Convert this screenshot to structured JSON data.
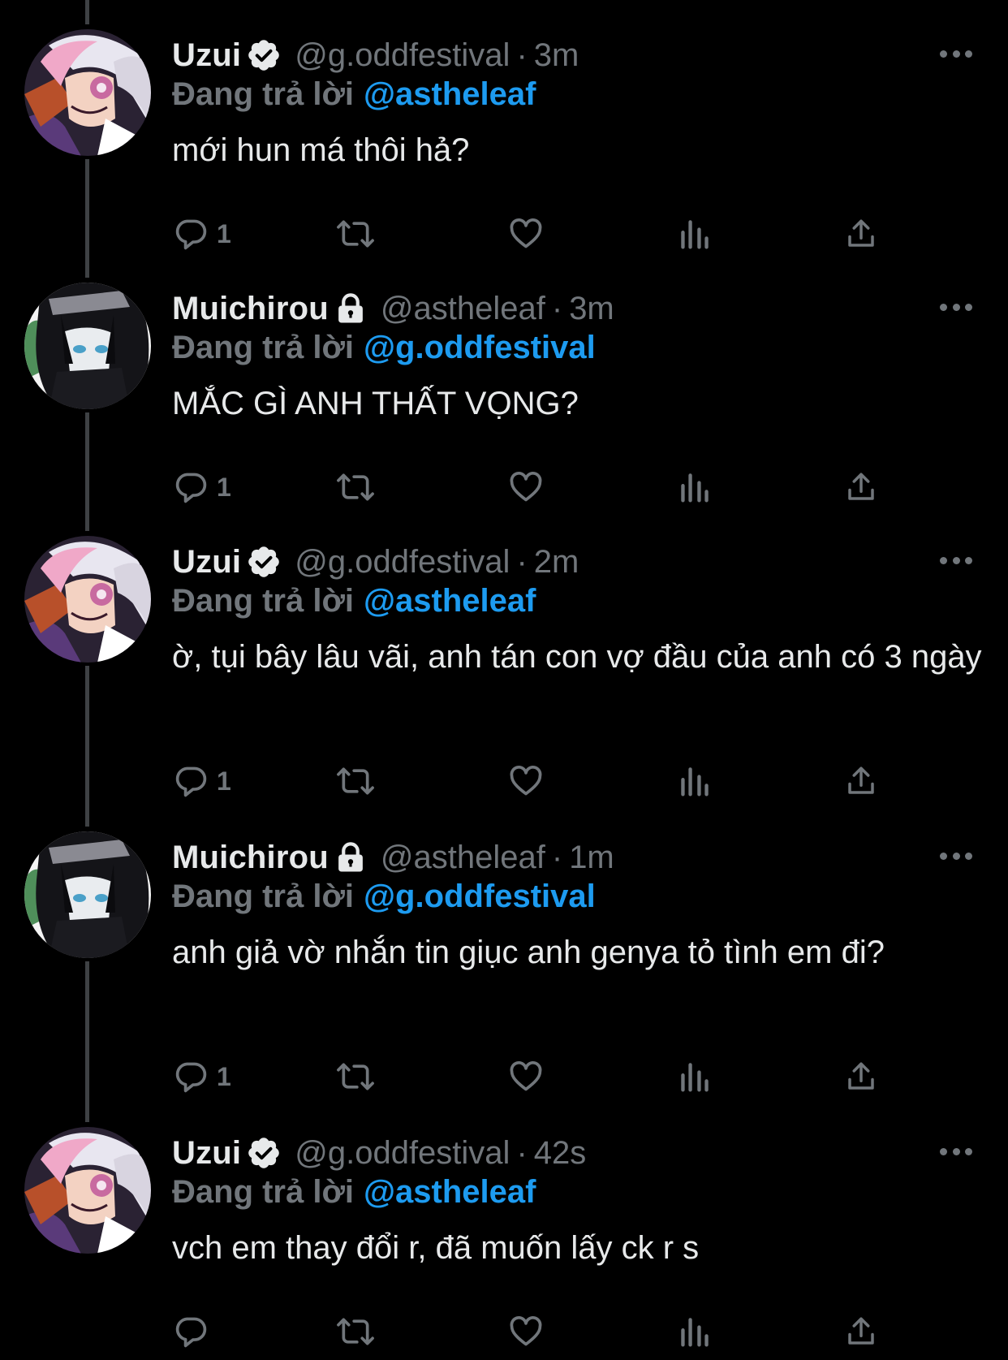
{
  "colors": {
    "background": "#000000",
    "text": "#e7e9ea",
    "muted": "#71767b",
    "accent": "#1d9bf0",
    "thread_line": "#3e4144"
  },
  "reply_label": "Đang trả lời",
  "tweets": [
    {
      "name": "Uzui",
      "badge": "verified-icon",
      "handle": "@g.oddfestival",
      "time": "3m",
      "reply_to": "@astheleaf",
      "text": "mới hun má thôi hả?",
      "reply_count": "1",
      "avatar": "uzui-avatar"
    },
    {
      "name": "Muichirou",
      "badge": "lock-icon",
      "handle": "@astheleaf",
      "time": "3m",
      "reply_to": "@g.oddfestival",
      "text": "MẮC GÌ ANH THẤT VỌNG?",
      "reply_count": "1",
      "avatar": "muichirou-avatar"
    },
    {
      "name": "Uzui",
      "badge": "verified-icon",
      "handle": "@g.oddfestival",
      "time": "2m",
      "reply_to": "@astheleaf",
      "text": "ờ, tụi bây lâu vãi, anh tán con vợ đầu của anh có 3 ngày",
      "reply_count": "1",
      "avatar": "uzui-avatar"
    },
    {
      "name": "Muichirou",
      "badge": "lock-icon",
      "handle": "@astheleaf",
      "time": "1m",
      "reply_to": "@g.oddfestival",
      "text": "anh giả vờ nhắn tin giục anh genya tỏ tình em đi?",
      "reply_count": "1",
      "avatar": "muichirou-avatar"
    },
    {
      "name": "Uzui",
      "badge": "verified-icon",
      "handle": "@g.oddfestival",
      "time": "42s",
      "reply_to": "@astheleaf",
      "text": "vch em thay đổi r, đã muốn lấy ck r s",
      "reply_count": "",
      "avatar": "uzui-avatar"
    }
  ]
}
